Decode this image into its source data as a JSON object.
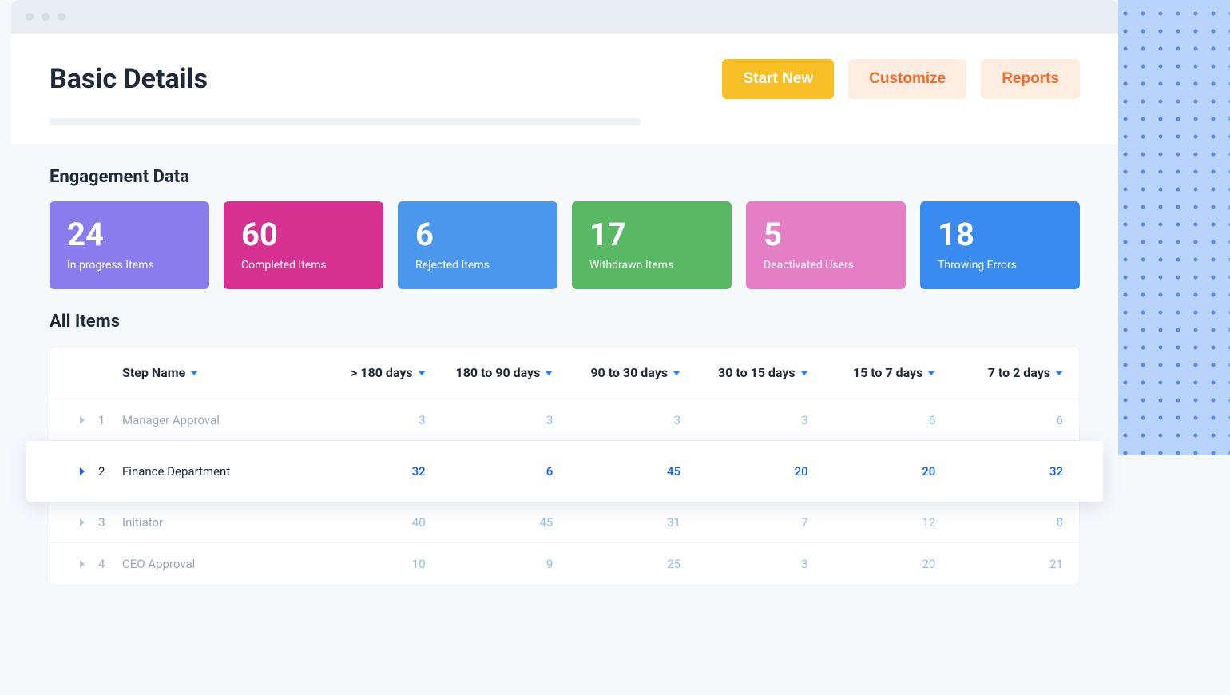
{
  "header": {
    "title": "Basic Details",
    "buttons": {
      "start": "Start New",
      "customize": "Customize",
      "reports": "Reports"
    }
  },
  "engagement": {
    "title": "Engagement Data",
    "cards": [
      {
        "value": "24",
        "label": "In progress Items",
        "color": "#8b7ced"
      },
      {
        "value": "60",
        "label": "Completed Items",
        "color": "#d63091"
      },
      {
        "value": "6",
        "label": "Rejected Items",
        "color": "#4a97ed"
      },
      {
        "value": "17",
        "label": "Withdrawn Items",
        "color": "#58b864"
      },
      {
        "value": "5",
        "label": "Deactivated Users",
        "color": "#e47fc6"
      },
      {
        "value": "18",
        "label": "Throwing Errors",
        "color": "#3a8bef"
      }
    ]
  },
  "table": {
    "title": "All Items",
    "columns": {
      "step": "Step Name",
      "c1": "> 180 days",
      "c2": "180 to 90 days",
      "c3": "90 to 30 days",
      "c4": "30 to 15 days",
      "c5": "15 to 7 days",
      "c6": "7 to 2 days"
    },
    "rows": [
      {
        "idx": "1",
        "name": "Manager Approval",
        "v": [
          "3",
          "3",
          "3",
          "3",
          "6",
          "6"
        ],
        "active": false
      },
      {
        "idx": "2",
        "name": "Finance Department",
        "v": [
          "32",
          "6",
          "45",
          "20",
          "20",
          "32"
        ],
        "active": true
      },
      {
        "idx": "3",
        "name": "Initiator",
        "v": [
          "40",
          "45",
          "31",
          "7",
          "12",
          "8"
        ],
        "active": false
      },
      {
        "idx": "4",
        "name": "CEO Approval",
        "v": [
          "10",
          "9",
          "25",
          "3",
          "20",
          "21"
        ],
        "active": false
      }
    ]
  }
}
